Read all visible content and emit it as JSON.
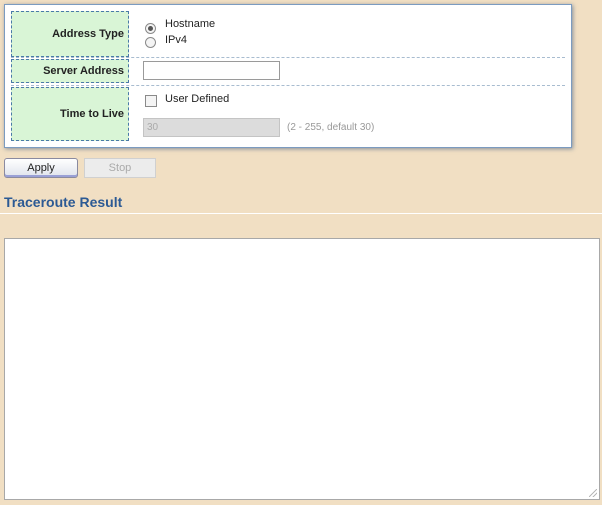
{
  "form": {
    "address_type": {
      "label": "Address Type",
      "options": [
        "Hostname",
        "IPv4"
      ],
      "selected": "Hostname"
    },
    "server_address": {
      "label": "Server Address",
      "value": ""
    },
    "time_to_live": {
      "label": "Time to Live",
      "user_defined_label": "User Defined",
      "user_defined_checked": false,
      "value": "30",
      "hint": "(2 - 255, default 30)"
    }
  },
  "buttons": {
    "apply": "Apply",
    "stop": "Stop"
  },
  "result": {
    "title": "Traceroute Result",
    "content": ""
  }
}
